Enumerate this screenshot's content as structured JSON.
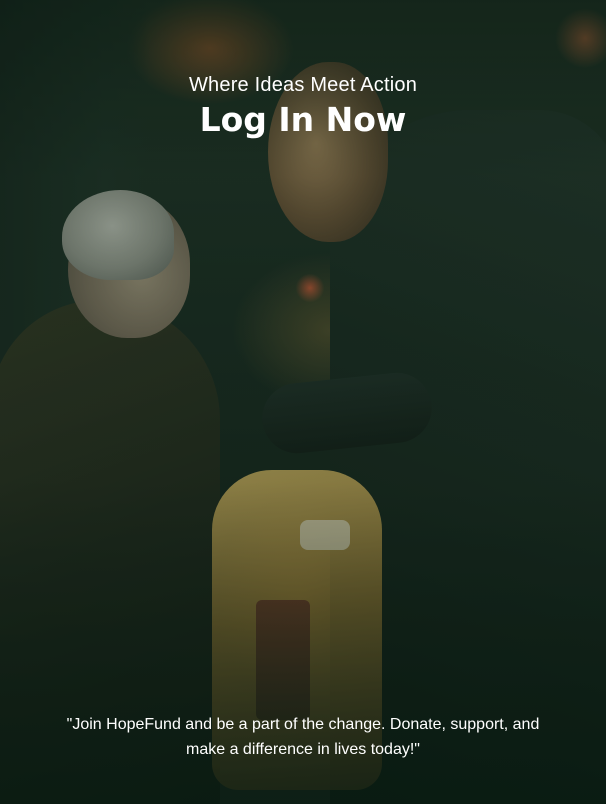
{
  "hero": {
    "tagline": "Where Ideas Meet Action",
    "title": "Log In Now",
    "quote": "\"Join HopeFund and be a part of the change. Donate, support, and make a difference in lives today!\""
  },
  "colors": {
    "overlay_tint": "#0c2618",
    "text": "#ffffff"
  }
}
